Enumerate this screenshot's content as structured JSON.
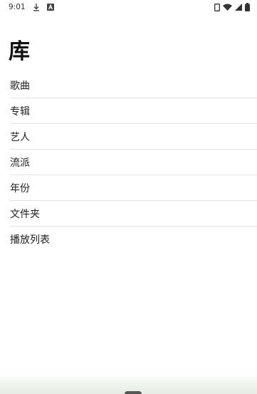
{
  "status_bar": {
    "time": "9:01",
    "left_icons": [
      "download-icon",
      "a-badge-icon"
    ],
    "right_icons": [
      "screen-rotate-icon",
      "wifi-icon",
      "cellular-signal-icon",
      "battery-icon"
    ]
  },
  "page": {
    "title": "库"
  },
  "library": {
    "items": [
      {
        "label": "歌曲"
      },
      {
        "label": "专辑"
      },
      {
        "label": "艺人"
      },
      {
        "label": "流派"
      },
      {
        "label": "年份"
      },
      {
        "label": "文件夹"
      },
      {
        "label": "播放列表"
      }
    ]
  },
  "colors": {
    "background": "#ffffff",
    "divider": "#e3e3e3",
    "text": "#1f1f1f",
    "bottom_tint": "#e6ede3"
  }
}
